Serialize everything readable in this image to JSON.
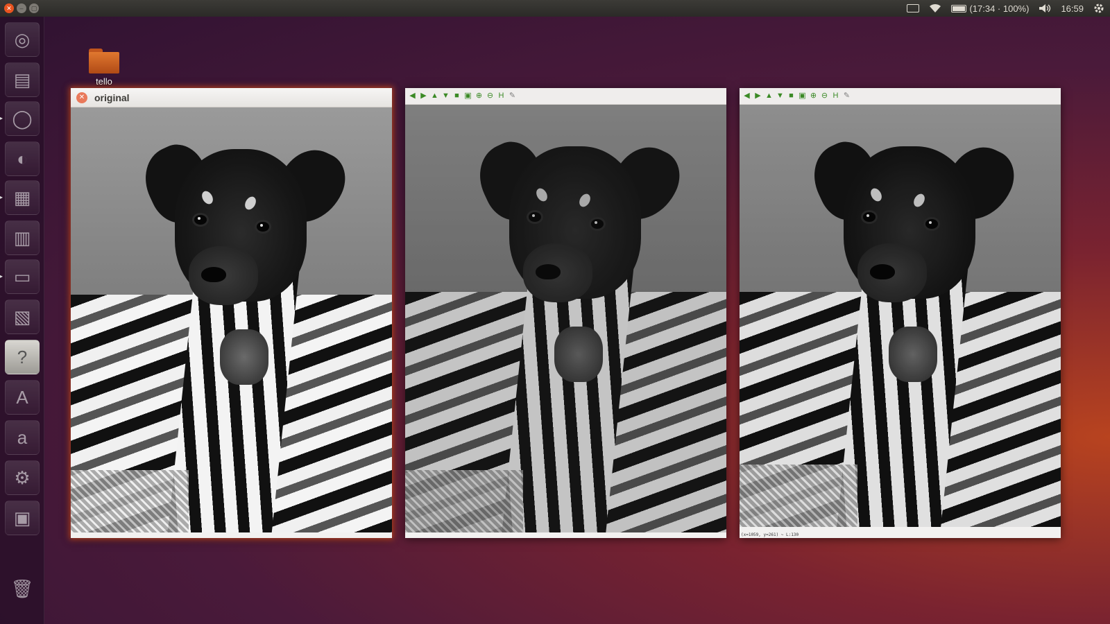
{
  "top_panel": {
    "battery_text": "(17:34 · 100%)",
    "clock": "16:59"
  },
  "desktop": {
    "folder_label": "tello"
  },
  "windows": [
    {
      "title": "original",
      "has_toolbar": false,
      "status": ""
    },
    {
      "title": "",
      "has_toolbar": true,
      "status": ""
    },
    {
      "title": "",
      "has_toolbar": true,
      "status": "(x=1059, y=261) ~ L:130"
    }
  ],
  "toolbar_icons": [
    "arrow-left-icon",
    "arrow-right-icon",
    "arrow-up-icon",
    "arrow-down-icon",
    "save-image-icon",
    "image-icon",
    "zoom-in-icon",
    "zoom-out-icon",
    "fit-icon",
    "properties-icon"
  ],
  "launcher_icons": [
    "ubuntu-dash-icon",
    "files-icon",
    "browser-icon",
    "thunderbird-icon",
    "writer-icon",
    "calc-icon",
    "terminal-icon",
    "impress-icon",
    "help-icon",
    "software-center-icon",
    "amazon-icon",
    "system-settings-icon",
    "workspaces-icon",
    "trash-icon"
  ],
  "colors": {
    "accent": "#e95420",
    "panel": "#3c3b37"
  }
}
